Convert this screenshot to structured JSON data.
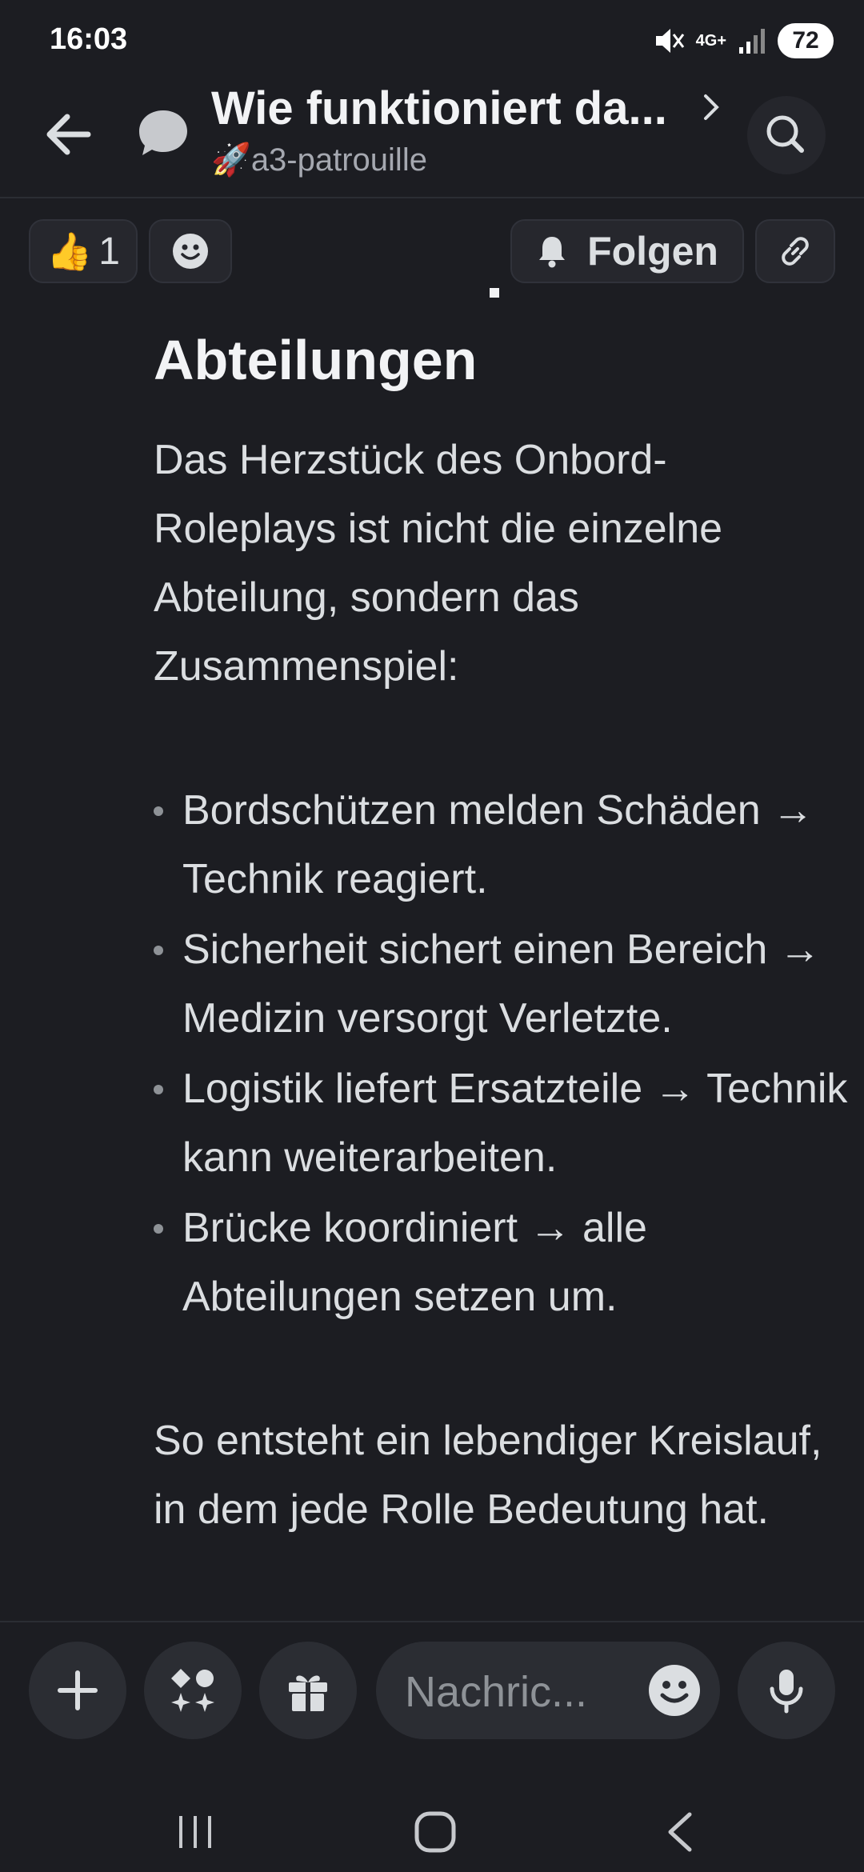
{
  "status_bar": {
    "time": "16:03",
    "network": "4G+",
    "battery": "72"
  },
  "header": {
    "title": "Wie funktioniert da...",
    "subtitle_emoji": "🚀",
    "subtitle": "a3-patrouille"
  },
  "reactions": {
    "thumbs_emoji": "👍",
    "thumbs_count": "1",
    "follow_label": "Folgen"
  },
  "content": {
    "heading": "Abteilungen",
    "intro": "Das Herzstück des Onbord-Roleplays ist nicht die einzelne Abteilung, sondern das Zusammenspiel:",
    "bullets": [
      "Bordschützen melden Schäden → Technik reagiert.",
      "Sicherheit sichert einen Bereich → Medizin versorgt Verletzte.",
      "Logistik liefert Ersatzteile → Technik kann weiterarbeiten.",
      "Brücke koordiniert → alle Abteilungen setzen um."
    ],
    "outro": "So entsteht ein lebendiger Kreislauf, in dem jede Rolle Bedeutung hat."
  },
  "composer": {
    "placeholder": "Nachric..."
  },
  "colors": {
    "background": "#1c1d22",
    "surface": "#2b2d33",
    "text": "#dbdee1",
    "muted": "#8e9297"
  }
}
